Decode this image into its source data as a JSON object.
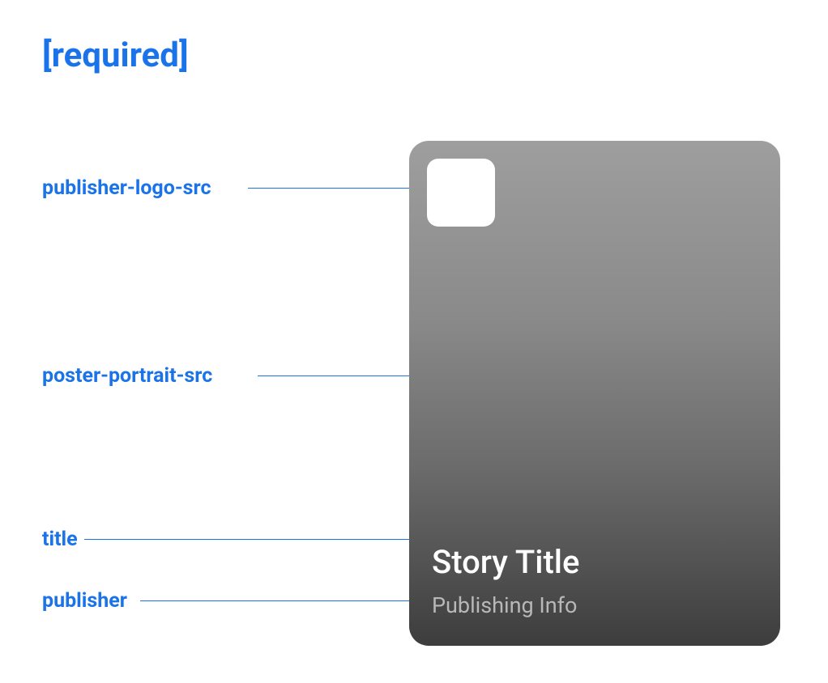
{
  "heading": "[required]",
  "labels": {
    "publisher_logo_src": "publisher-logo-src",
    "poster_portrait_src": "poster-portrait-src",
    "title": "title",
    "publisher": "publisher"
  },
  "card": {
    "story_title": "Story Title",
    "publishing_info": "Publishing Info"
  },
  "colors": {
    "accent": "#1a73e8",
    "card_gradient_start": "#9e9e9e",
    "card_gradient_end": "#3d3d3d"
  }
}
